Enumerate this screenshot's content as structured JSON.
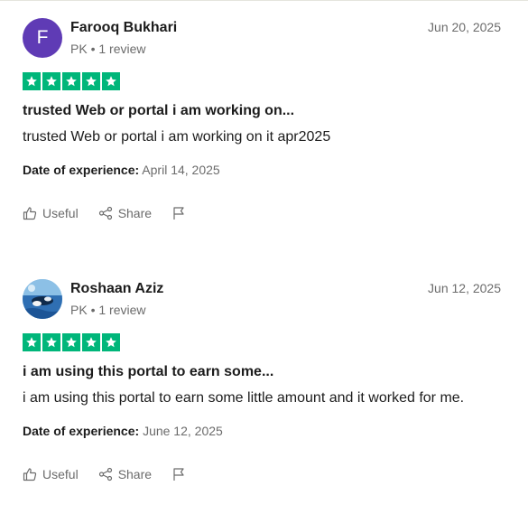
{
  "reviews": [
    {
      "avatar": {
        "type": "initial",
        "initial": "F",
        "color": "#5f3bb5"
      },
      "name": "Farooq Bukhari",
      "meta": "PK • 1 review",
      "date": "Jun 20, 2025",
      "rating": 5,
      "star_color": "#00b67a",
      "title": "trusted Web or portal i am working on...",
      "body": "trusted Web or portal i am working on it apr2025",
      "experience_label": "Date of experience:",
      "experience_date": "April 14, 2025",
      "actions": {
        "useful_label": "Useful",
        "share_label": "Share"
      }
    },
    {
      "avatar": {
        "type": "photo",
        "description_icon": "profile-photo"
      },
      "name": "Roshaan Aziz",
      "meta": "PK • 1 review",
      "date": "Jun 12, 2025",
      "rating": 5,
      "star_color": "#00b67a",
      "title": "i am using this portal to earn some...",
      "body": "i am using this portal to earn some little amount and it worked for me.",
      "experience_label": "Date of experience:",
      "experience_date": "June 12, 2025",
      "actions": {
        "useful_label": "Useful",
        "share_label": "Share"
      }
    }
  ]
}
